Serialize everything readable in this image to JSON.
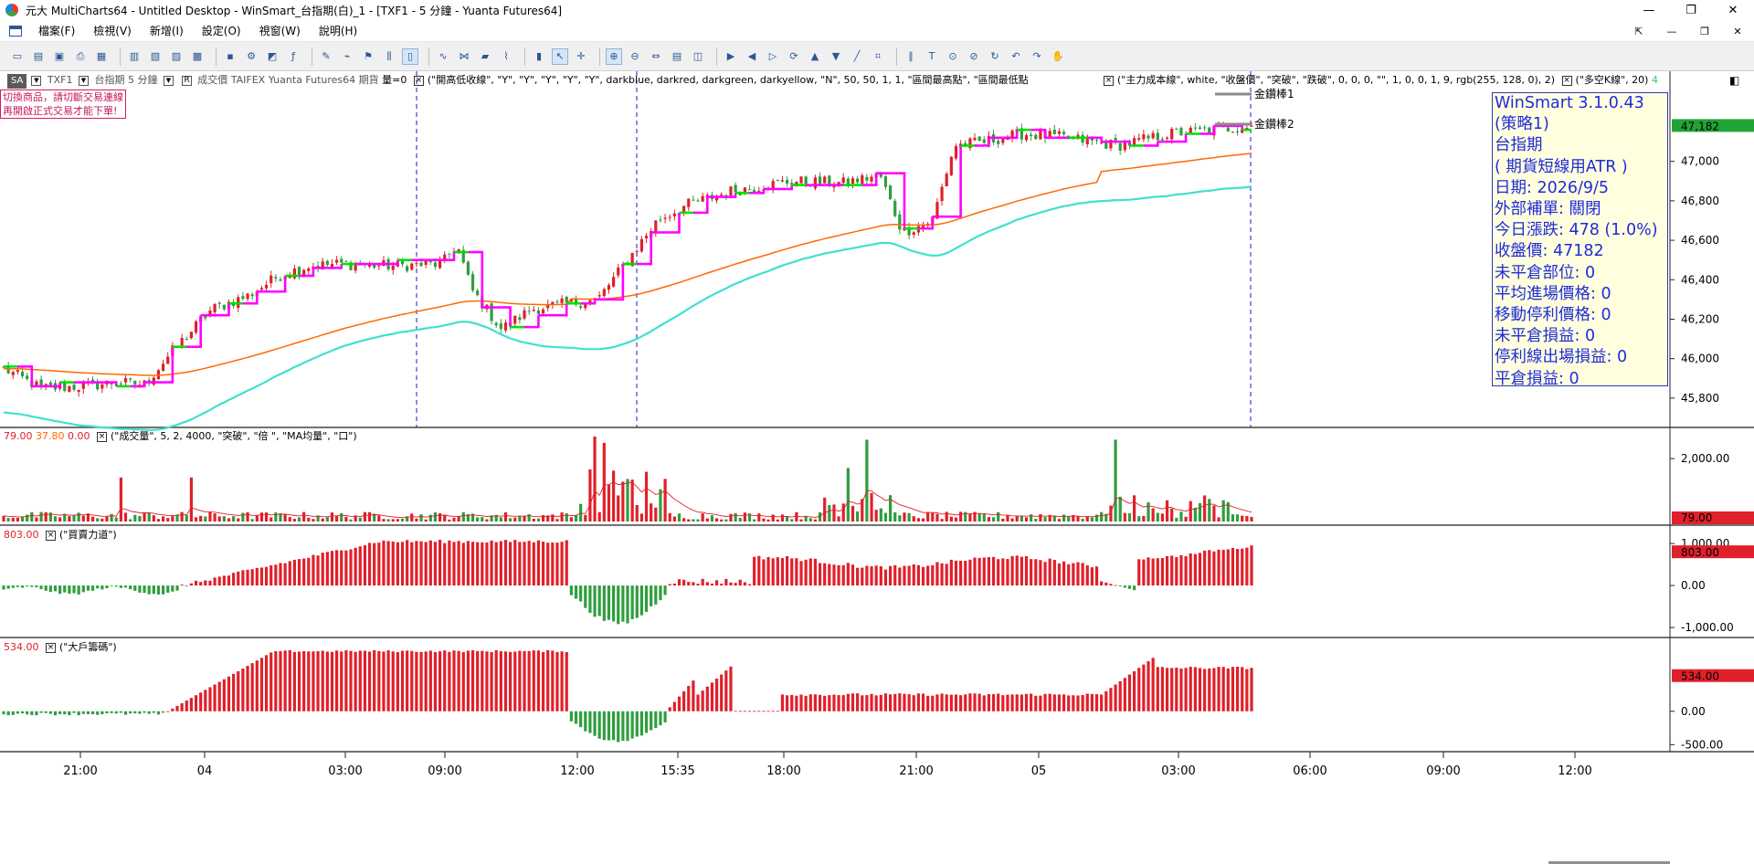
{
  "window": {
    "title": "元大 MultiCharts64 - Untitled Desktop - WinSmart_台指期(白)_1 - [TXF1 - 5 分鐘 - Yuanta Futures64]",
    "buttons": [
      "—",
      "❐",
      "✕"
    ]
  },
  "menu": {
    "items": [
      "檔案(F)",
      "檢視(V)",
      "新增(I)",
      "設定(O)",
      "視窗(W)",
      "說明(H)"
    ],
    "mdi_buttons": [
      "⇱",
      "—",
      "❐",
      "✕"
    ]
  },
  "toolbar": {
    "icons": [
      "new-window-icon",
      "open-folder-icon",
      "save-icon",
      "print-icon",
      "workspace-icon",
      "chart-window-icon",
      "scanner-icon",
      "dom-icon",
      "quote-icon",
      "order-icon",
      "settings-icon",
      "formats-icon",
      "indicator-icon",
      "strategy-icon",
      "drawing-icon",
      "alert-icon",
      "bar-chart-icon",
      "candlestick-icon",
      "line-chart-icon",
      "point-figure-icon",
      "renko-icon",
      "kagi-icon",
      "volume-bar-icon",
      "cursor-icon",
      "crosshair-icon",
      "zoom-in-icon",
      "zoom-out-icon",
      "scroll-icon",
      "data-window-icon",
      "status-icon",
      "playback-icon",
      "step-back-icon",
      "step-forward-icon",
      "sync-icon",
      "up-icon",
      "down-icon",
      "trendline-icon",
      "fib-icon",
      "channel-icon",
      "text-icon",
      "magnify-icon",
      "reduce-icon",
      "refresh-icon",
      "undo-icon",
      "redo-icon",
      "hand-icon"
    ]
  },
  "main_status": {
    "symbol_select": "SA",
    "symbol": "TXF1",
    "name": "台指期",
    "interval": "5 分鐘",
    "mode": "R",
    "field": "成交價",
    "exchange": "TAIFEX",
    "datasource": "Yuanta Futures64",
    "category": "期貨",
    "volume_label": "量=0",
    "study1": "(\"開高低收線\", \"Y\", \"Y\", \"Y\", \"Y\", \"Y\", darkblue, darkred, darkgreen, darkyellow, \"N\", 50, 50, 1, 1, \"區間最高點\", \"區間最低點",
    "study2": "(\"主力成本線\", white, \"收盤價\", \"突破\", \"跌破\", 0, 0, 0, \"\", 1, 0, 0, 1, 9, rgb(255, 128, 0), 2)",
    "study3": "(\"多空K線\", 20)",
    "study3_tail": "4"
  },
  "warning": {
    "line1": "切換商品，請切斷交易連線",
    "line2": "再開啟正式交易才能下單!"
  },
  "info_panel": {
    "lines": [
      "WinSmart 3.1.0.43",
      "(策略1)",
      "台指期",
      "( 期貨短線用ATR )",
      "日期: 2026/9/5",
      "外部補單: 關閉",
      "今日漲跌: 478 (1.0%)",
      "收盤價: 47182",
      "未平倉部位: 0",
      "平均進場價格: 0",
      "移動停利價格: 0",
      "未平倉損益: 0",
      "停利線出場損益: 0",
      "平倉損益: 0"
    ]
  },
  "price_pane": {
    "labels": [
      "金鑽棒1",
      "金鑽棒2"
    ],
    "last_price_tag": "47,182",
    "y_ticks": [
      "47,000",
      "46,800",
      "46,600",
      "46,400",
      "46,200",
      "46,000",
      "45,800"
    ],
    "y_tick_values": [
      47000,
      46800,
      46600,
      46400,
      46200,
      46000,
      45800
    ],
    "y_range": [
      45730,
      47420
    ],
    "colors": {
      "up": "#e0202a",
      "down": "#2e9e3e",
      "magenta": "#ff00ff",
      "green": "#00e000",
      "cyan": "#40e0d0",
      "orange": "#ff6a00"
    }
  },
  "volume_pane": {
    "status_values": [
      "79.00",
      "37.80",
      "0.00"
    ],
    "study": "(\"成交量\", 5, 2, 4000, \"突破\", \"倍 \", \"MA均量\", \"口\")",
    "y_ticks": [
      "2,000.00"
    ],
    "y_tick_values": [
      2000
    ],
    "y_range": [
      0,
      2700
    ],
    "last_tag": "79.00"
  },
  "buy_power_pane": {
    "status_value": "803.00",
    "study": "(\"買賣力道\")",
    "y_ticks": [
      "1,000.00",
      "0.00",
      "-1,000.00"
    ],
    "y_tick_values": [
      1000,
      0,
      -1000
    ],
    "y_range": [
      -1150,
      1350
    ],
    "last_tag": "803.00"
  },
  "big_player_pane": {
    "status_value": "534.00",
    "study": "(\"大戶籌碼\")",
    "y_ticks": [
      "0.00",
      "-500.00"
    ],
    "y_tick_values": [
      0,
      -500
    ],
    "y_range": [
      -550,
      1050
    ],
    "last_tag": "534.00"
  },
  "time_axis": {
    "labels": [
      "21:00",
      "04",
      "03:00",
      "09:00",
      "12:00",
      "15:35",
      "18:00",
      "21:00",
      "05",
      "03:00",
      "06:00",
      "09:00",
      "12:00"
    ]
  }
}
